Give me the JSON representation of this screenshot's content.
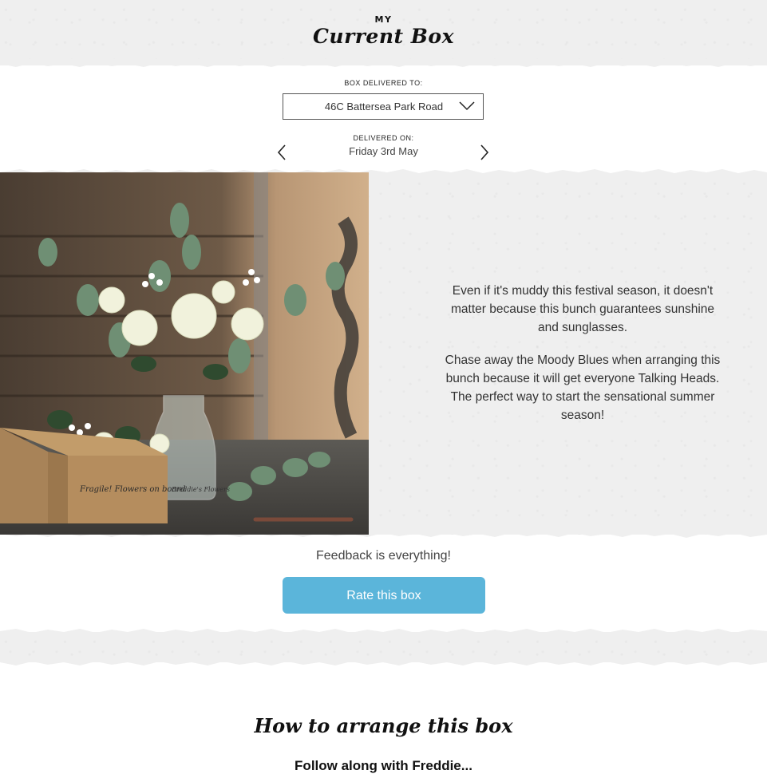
{
  "header": {
    "title_small": "MY",
    "title_main": "Current Box"
  },
  "delivery": {
    "address_label": "BOX DELIVERED TO:",
    "address_value": "46C Battersea Park Road",
    "date_label": "DELIVERED ON:",
    "date_value": "Friday 3rd May"
  },
  "description": {
    "paragraph_1": "Even if it's muddy this festival season, it doesn't matter because this bunch guarantees sunshine and sunglasses.",
    "paragraph_2": "Chase away the Moody Blues when arranging this bunch because it will get everyone Talking Heads. The perfect way to start the sensational summer season!"
  },
  "photo": {
    "box_caption": "Fragile! Flowers on board",
    "brand_stamp": "Freddie's Flowers"
  },
  "feedback": {
    "prompt": "Feedback is everything!",
    "button_label": "Rate this box"
  },
  "arrange": {
    "title": "How to arrange this box",
    "subtitle": "Follow along with Freddie..."
  },
  "colors": {
    "accent": "#5bb5da",
    "paper": "#efefef"
  }
}
